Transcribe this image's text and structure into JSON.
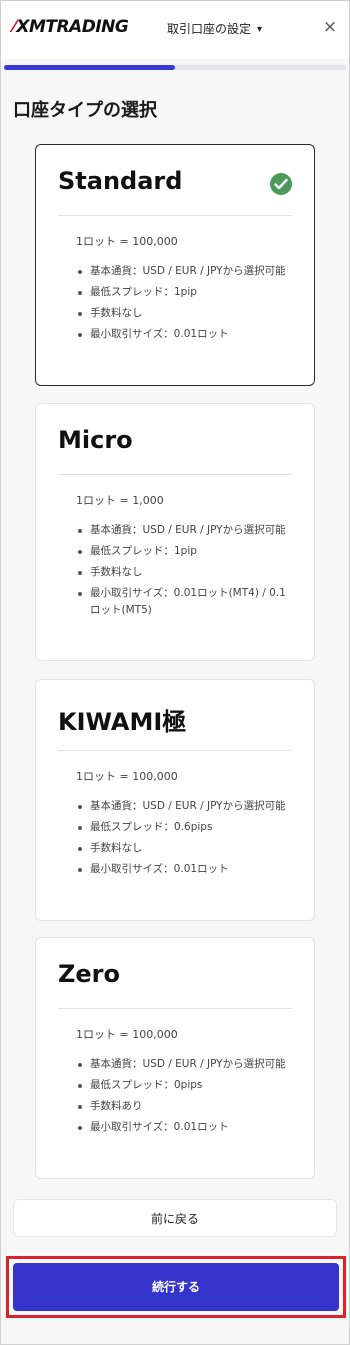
{
  "header": {
    "logo": "XMTRADING",
    "menu_label": "取引口座の設定",
    "close_symbol": "×"
  },
  "progress": {
    "value_percent": 50
  },
  "section_title": "口座タイプの選択",
  "cards": [
    {
      "title": "Standard",
      "selected": true,
      "lot": "1ロット = 100,000",
      "features": [
        "基本通貨：USD / EUR / JPYから選択可能",
        "最低スプレッド：1pip",
        "手数料なし",
        "最小取引サイズ：0.01ロット"
      ]
    },
    {
      "title": "Micro",
      "selected": false,
      "lot": "1ロット = 1,000",
      "features": [
        "基本通貨：USD / EUR / JPYから選択可能",
        "最低スプレッド：1pip",
        "手数料なし",
        "最小取引サイズ：0.01ロット(MT4) / 0.1ロット(MT5)"
      ]
    },
    {
      "title": "KIWAMI極",
      "selected": false,
      "lot": "1ロット = 100,000",
      "features": [
        "基本通貨：USD / EUR / JPYから選択可能",
        "最低スプレッド：0.6pips",
        "手数料なし",
        "最小取引サイズ：0.01ロット"
      ]
    },
    {
      "title": "Zero",
      "selected": false,
      "lot": "1ロット = 100,000",
      "features": [
        "基本通貨：USD / EUR / JPYから選択可能",
        "最低スプレッド：0pips",
        "手数料あり",
        "最小取引サイズ：0.01ロット"
      ]
    }
  ],
  "buttons": {
    "back": "前に戻る",
    "continue": "続行する"
  },
  "colors": {
    "accent": "#3434cc",
    "check": "#4a9b5a",
    "highlight": "#d9232a",
    "logo_mark": "#d71920"
  }
}
